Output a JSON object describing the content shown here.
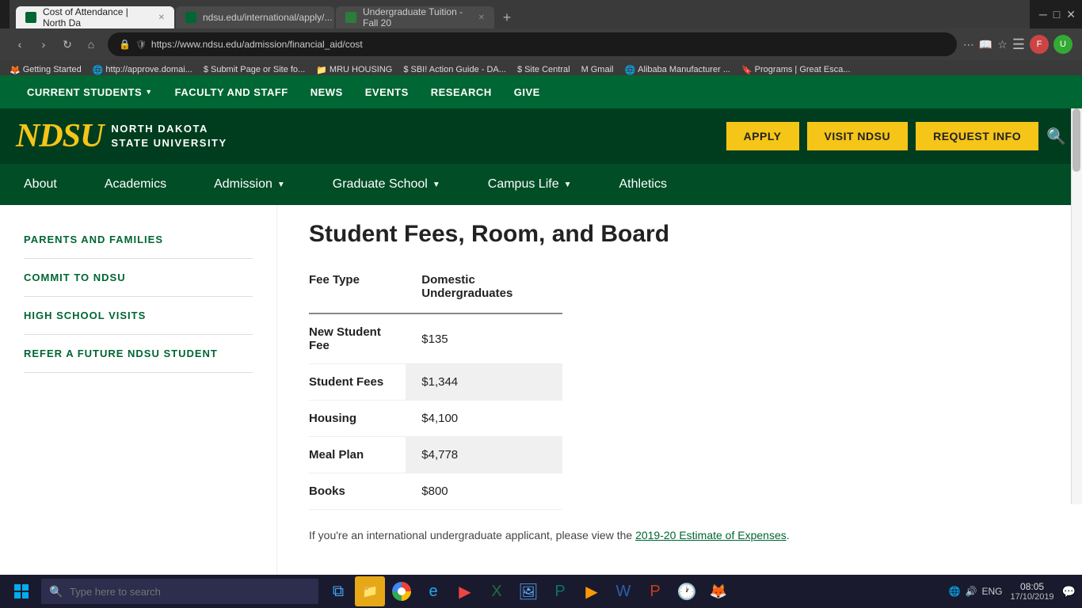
{
  "browser": {
    "tabs": [
      {
        "id": "tab1",
        "label": "Cost of Attendance | North Da",
        "favicon_color": "#006633",
        "active": true
      },
      {
        "id": "tab2",
        "label": "ndsu.edu/international/apply/...",
        "favicon_color": "#006633",
        "active": false
      },
      {
        "id": "tab3",
        "label": "Undergraduate Tuition - Fall 20",
        "favicon_color": "#2a7d3b",
        "active": false
      }
    ],
    "address": "https://www.ndsu.edu/admission/financial_aid/cost",
    "add_tab_label": "+",
    "bookmarks": [
      {
        "label": "Getting Started"
      },
      {
        "label": "http://approve.domai..."
      },
      {
        "label": "Submit Page or Site fo..."
      },
      {
        "label": "MRU HOUSING"
      },
      {
        "label": "SBI! Action Guide - DA..."
      },
      {
        "label": "Site Central"
      },
      {
        "label": "Gmail"
      },
      {
        "label": "Alibaba Manufacturer ..."
      },
      {
        "label": "Programs | Great Esca..."
      }
    ]
  },
  "top_nav": {
    "items": [
      {
        "label": "CURRENT STUDENTS",
        "has_arrow": true
      },
      {
        "label": "FACULTY AND STAFF",
        "has_arrow": false
      },
      {
        "label": "NEWS",
        "has_arrow": false
      },
      {
        "label": "EVENTS",
        "has_arrow": false
      },
      {
        "label": "RESEARCH",
        "has_arrow": false
      },
      {
        "label": "GIVE",
        "has_arrow": false
      }
    ]
  },
  "header": {
    "logo_text_line1": "NORTH DAKOTA",
    "logo_text_line2": "STATE UNIVERSITY",
    "logo_abbr": "NDSU",
    "btn_apply": "APPLY",
    "btn_visit": "VISIT NDSU",
    "btn_request": "REQUEST INFO"
  },
  "main_nav": {
    "items": [
      {
        "label": "About",
        "has_arrow": false
      },
      {
        "label": "Academics",
        "has_arrow": false
      },
      {
        "label": "Admission",
        "has_arrow": true
      },
      {
        "label": "Graduate School",
        "has_arrow": true
      },
      {
        "label": "Campus Life",
        "has_arrow": true
      },
      {
        "label": "Athletics",
        "has_arrow": false
      }
    ]
  },
  "sidebar": {
    "items": [
      {
        "label": "PARENTS AND FAMILIES"
      },
      {
        "label": "COMMIT TO NDSU"
      },
      {
        "label": "HIGH SCHOOL VISITS"
      },
      {
        "label": "REFER A FUTURE NDSU STUDENT"
      }
    ]
  },
  "page": {
    "title": "Student Fees, Room, and Board",
    "table": {
      "col_type": "Fee Type",
      "col_domestic": "Domestic Undergraduates",
      "rows": [
        {
          "type": "New Student Fee",
          "amount": "$135",
          "shaded": false
        },
        {
          "type": "Student Fees",
          "amount": "$1,344",
          "shaded": true
        },
        {
          "type": "Housing",
          "amount": "$4,100",
          "shaded": false
        },
        {
          "type": "Meal Plan",
          "amount": "$4,778",
          "shaded": true
        },
        {
          "type": "Books",
          "amount": "$800",
          "shaded": false
        }
      ]
    },
    "intl_note": "If you're an international undergraduate applicant, please view the ",
    "intl_link": "2019-20 Estimate of Expenses",
    "intl_note_end": "."
  },
  "taskbar": {
    "search_placeholder": "Type here to search",
    "time": "08:05",
    "date": "17/10/2019",
    "lang": "ENG"
  }
}
